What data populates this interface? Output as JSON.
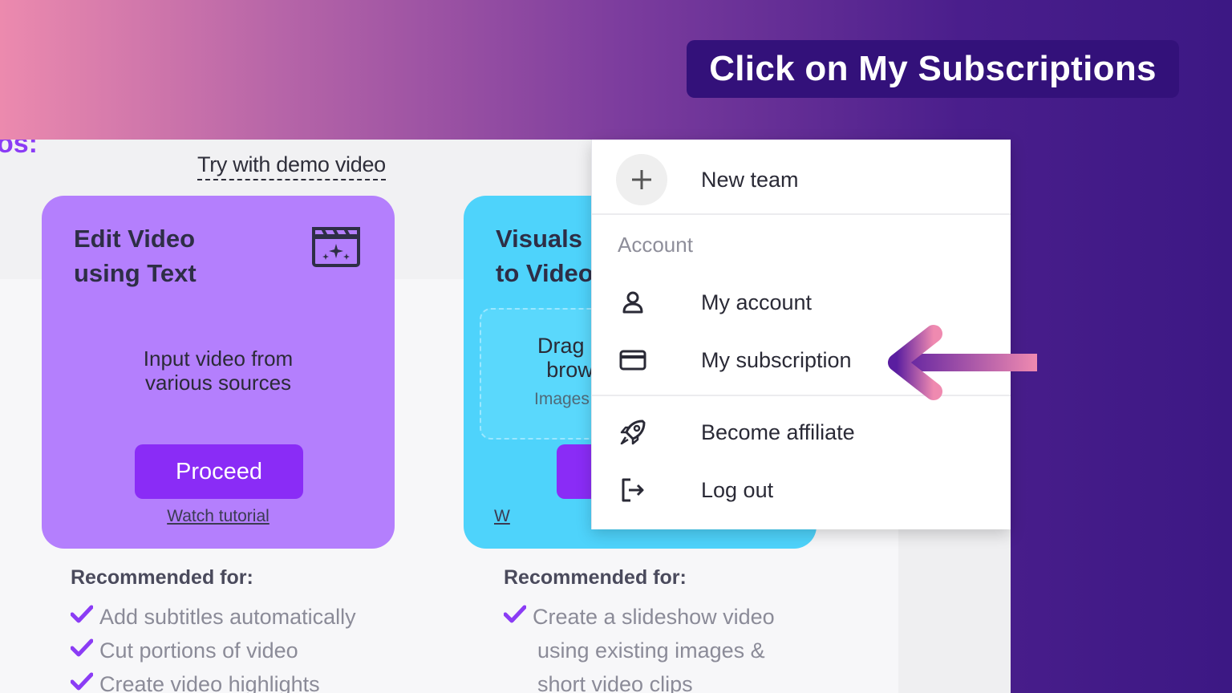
{
  "instruction": {
    "text": "Click on My Subscriptions"
  },
  "page": {
    "heading_fragment": "os:",
    "demo_link": "Try with demo video"
  },
  "cards": [
    {
      "title": "Edit Video\nusing Text",
      "icon": "clapperboard-sparkle-icon",
      "description": "Input video from\nvarious sources",
      "button": "Proceed",
      "tutorial": "Watch tutorial",
      "color": "#b47ffd"
    },
    {
      "title": "Visuals\nto Video",
      "dropzone_text": "Drag a\nbrow",
      "dropzone_sub": "Images",
      "tutorial": "W",
      "color": "#4ed3fb"
    }
  ],
  "recommended": [
    {
      "title": "Recommended for:",
      "items": [
        "Add subtitles automatically",
        "Cut portions of video",
        "Create video highlights"
      ]
    },
    {
      "title": "Recommended for:",
      "items": [
        "Create a slideshow video",
        "using existing images &",
        "short video clips"
      ]
    }
  ],
  "menu": {
    "new_team": "New team",
    "section": "Account",
    "items": [
      {
        "label": "My account",
        "icon": "user-icon"
      },
      {
        "label": "My subscription",
        "icon": "credit-card-icon"
      },
      {
        "label": "Become affiliate",
        "icon": "rocket-icon"
      },
      {
        "label": "Log out",
        "icon": "logout-icon"
      }
    ]
  },
  "colors": {
    "accent": "#8a2cf6",
    "banner": "#33117a",
    "check": "#8b3cf5"
  }
}
